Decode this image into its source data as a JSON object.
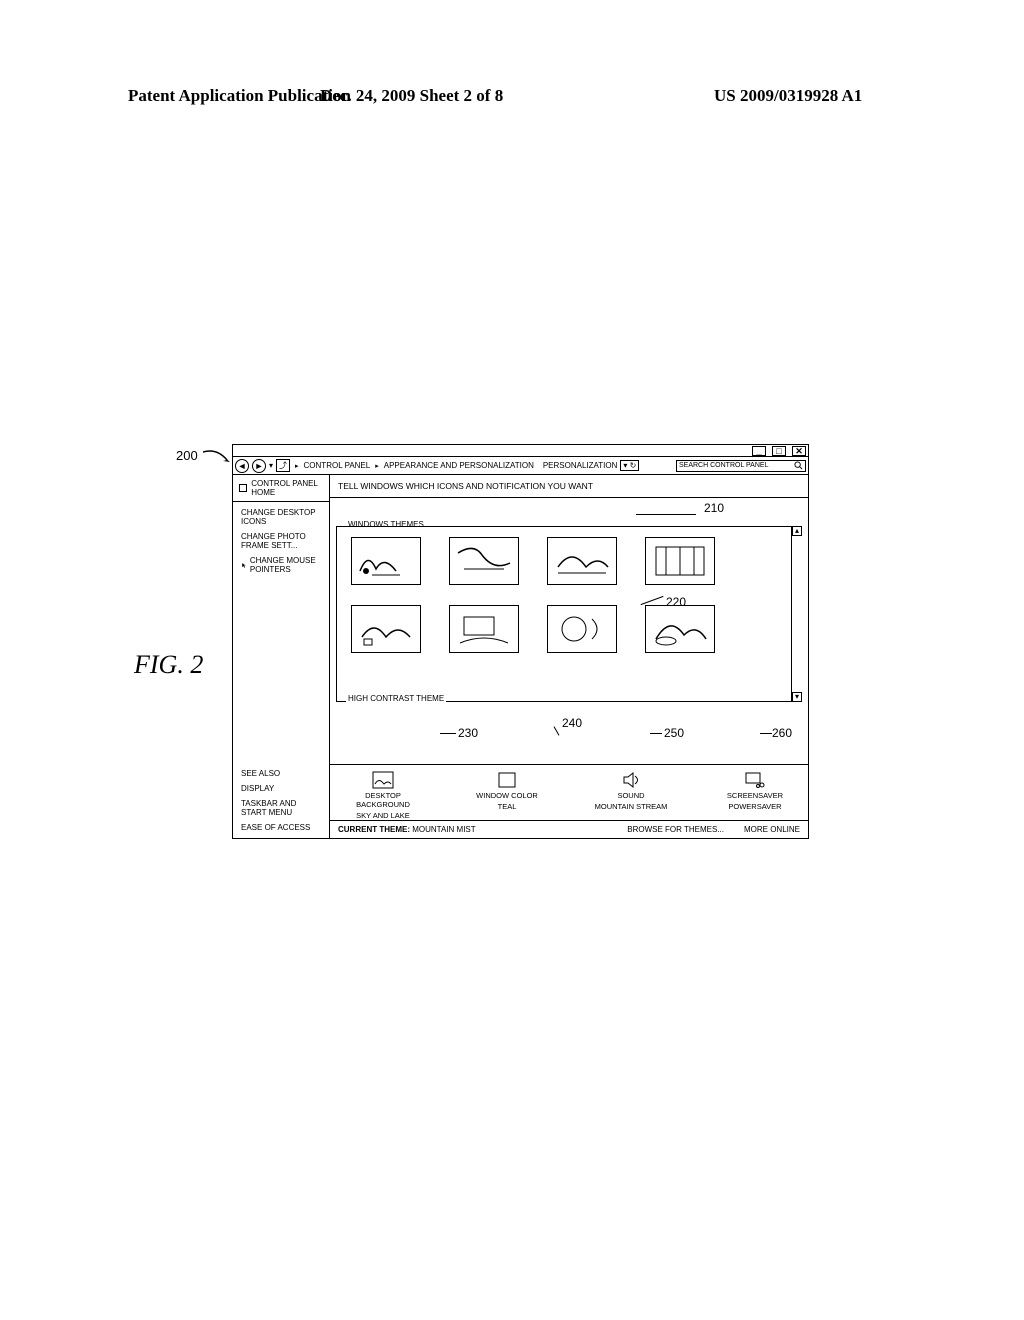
{
  "header": {
    "left": "Patent Application Publication",
    "center": "Dec. 24, 2009  Sheet 2 of 8",
    "right": "US 2009/0319928 A1"
  },
  "figure_label": "FIG. 2",
  "ref_200": "200",
  "window": {
    "min_label": "_",
    "max_label": "□",
    "close_label": "✕",
    "nav_back": "◄",
    "nav_fwd": "►",
    "breadcrumb": {
      "control_panel": "CONTROL PANEL",
      "appearance": "APPEARANCE AND PERSONALIZATION",
      "personalization": "PERSONALIZATION"
    },
    "search_placeholder": "SEARCH CONTROL PANEL"
  },
  "sidebar": {
    "home": "CONTROL PANEL HOME",
    "links": {
      "desktop_icons": "CHANGE DESKTOP ICONS",
      "photo_frame": "CHANGE PHOTO FRAME SETT...",
      "mouse_pointers": "CHANGE MOUSE POINTERS"
    },
    "see_also_label": "SEE ALSO",
    "see_also": {
      "display": "DISPLAY",
      "taskbar": "TASKBAR AND START MENU",
      "ease": "EASE OF ACCESS"
    }
  },
  "main": {
    "title": "TELL WINDOWS WHICH ICONS AND NOTIFICATION YOU WANT",
    "section_windows_themes": "WINDOWS THEMES",
    "section_high_contrast": "HIGH CONTRAST THEME"
  },
  "settings": {
    "desktop_bg": {
      "label": "DESKTOP BACKGROUND",
      "value": "SKY AND LAKE"
    },
    "window_color": {
      "label": "WINDOW COLOR",
      "value": "TEAL"
    },
    "sound": {
      "label": "SOUND",
      "value": "MOUNTAIN STREAM"
    },
    "screensaver": {
      "label": "SCREENSAVER",
      "value": "POWERSAVER"
    }
  },
  "status": {
    "current_theme_label": "CURRENT THEME:",
    "current_theme_value": "MOUNTAIN MIST",
    "browse": "BROWSE FOR THEMES...",
    "more_online": "MORE ONLINE"
  },
  "refs": {
    "r210": "210",
    "r220": "220",
    "r230": "230",
    "r240": "240",
    "r250": "250",
    "r260": "260"
  }
}
